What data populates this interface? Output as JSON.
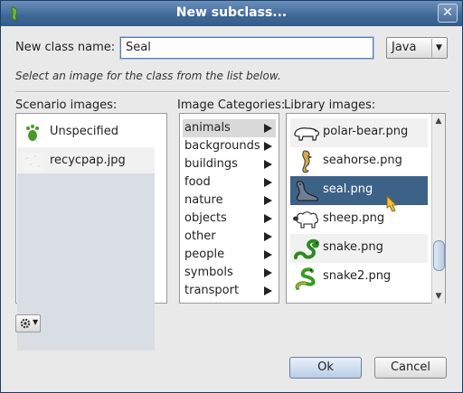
{
  "window": {
    "title": "New subclass...",
    "close_label": "✕"
  },
  "form": {
    "class_name_label": "New class name:",
    "class_name_value": "Seal",
    "language_value": "Java",
    "hint": "Select an image for the class from the list below."
  },
  "scenario": {
    "label": "Scenario images:",
    "items": [
      {
        "label": "Unspecified",
        "icon": "green-footprint-icon"
      },
      {
        "label": "recycpap.jpg",
        "icon": "paper-texture-icon"
      }
    ]
  },
  "categories": {
    "label": "Image Categories:",
    "selected": "animals",
    "items": [
      "animals",
      "backgrounds",
      "buildings",
      "food",
      "nature",
      "objects",
      "other",
      "people",
      "symbols",
      "transport"
    ]
  },
  "library": {
    "label": "Library images:",
    "selected": "seal.png",
    "items": [
      {
        "label": "polar-bear.png",
        "icon": "polar-bear-icon"
      },
      {
        "label": "seahorse.png",
        "icon": "seahorse-icon"
      },
      {
        "label": "seal.png",
        "icon": "seal-icon"
      },
      {
        "label": "sheep.png",
        "icon": "sheep-icon"
      },
      {
        "label": "snake.png",
        "icon": "snake-icon"
      },
      {
        "label": "snake2.png",
        "icon": "snake2-icon"
      }
    ]
  },
  "footer": {
    "gear_menu_icon": "gear-icon",
    "ok_label": "Ok",
    "cancel_label": "Cancel"
  },
  "colors": {
    "title_bar": "#3f6796",
    "selection": "#3d6288",
    "field_border": "#5a7ea8"
  }
}
